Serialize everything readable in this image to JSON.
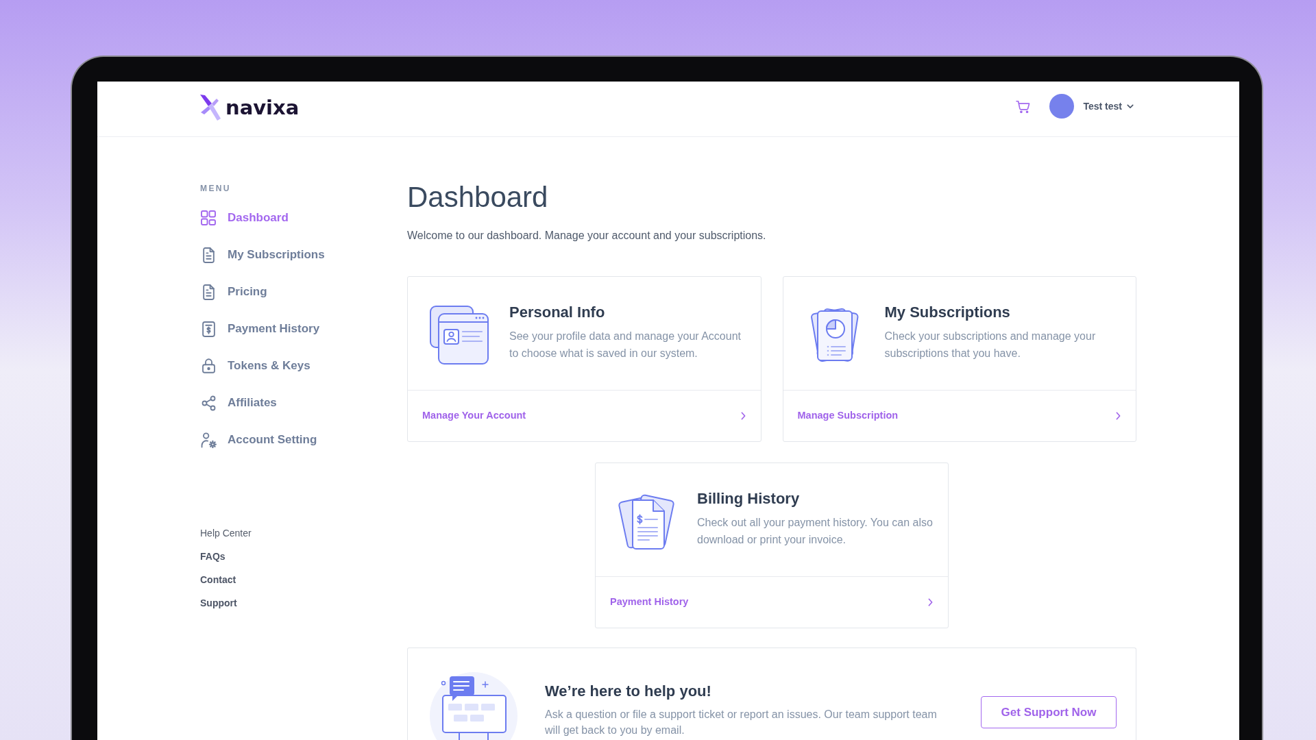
{
  "header": {
    "logo": "navixa",
    "user_name": "Test test"
  },
  "sidebar": {
    "heading": "MENU",
    "items": [
      {
        "label": "Dashboard",
        "selected": true
      },
      {
        "label": "My Subscriptions",
        "selected": false
      },
      {
        "label": "Pricing",
        "selected": false
      },
      {
        "label": "Payment History",
        "selected": false
      },
      {
        "label": "Tokens & Keys",
        "selected": false
      },
      {
        "label": "Affiliates",
        "selected": false
      },
      {
        "label": "Account Setting",
        "selected": false
      }
    ],
    "help": {
      "heading": "Help Center",
      "links": [
        "FAQs",
        "Contact",
        "Support"
      ]
    }
  },
  "page": {
    "title": "Dashboard",
    "subtitle": "Welcome to our dashboard. Manage your account and your subscriptions."
  },
  "cards": [
    {
      "title": "Personal Info",
      "description": "See your profile data and manage your Account to choose what is saved in our system.",
      "link": "Manage Your Account"
    },
    {
      "title": "My Subscriptions",
      "description": "Check your subscriptions and manage your subscriptions that you have.",
      "link": "Manage Subscription"
    },
    {
      "title": "Billing History",
      "description": "Check out all your payment history. You can also download or print your invoice.",
      "link": "Payment History"
    }
  ],
  "support": {
    "title": "We’re here to help you!",
    "description": "Ask a question or file a support ticket or report an issues. Our team support team will get back to you by email.",
    "button": "Get Support Now"
  }
}
